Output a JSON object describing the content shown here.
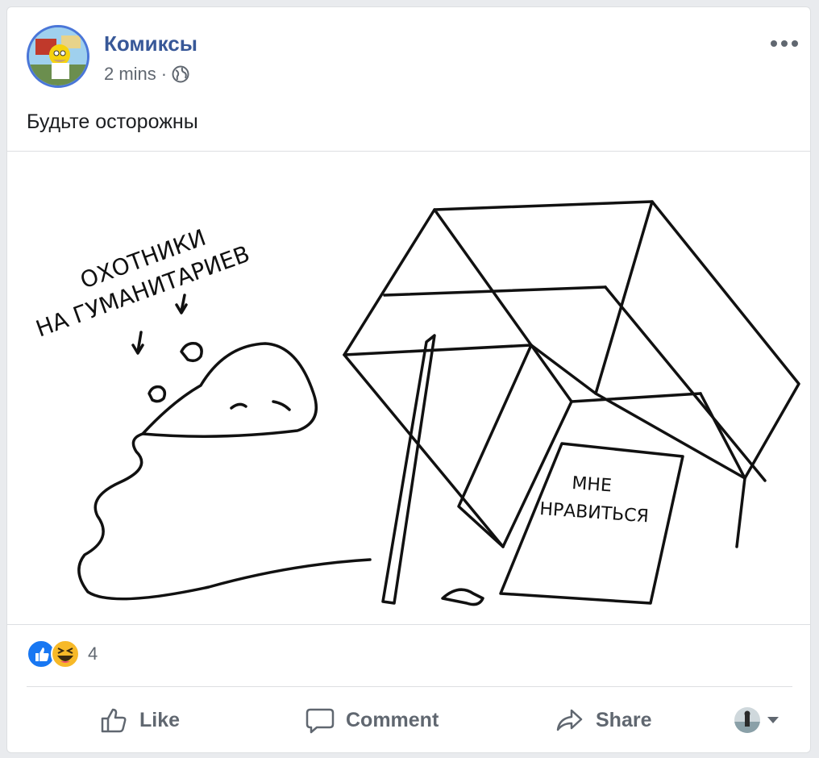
{
  "post": {
    "page_name": "Комиксы",
    "time": "2 mins",
    "separator": "·",
    "privacy_icon": "globe-icon",
    "more_icon": "more-icon",
    "text": "Будьте осторожны"
  },
  "comic": {
    "label_left_line1": "ОХОТНИКИ",
    "label_left_line2": "НА ГУМАНИТАРИЕВ",
    "sign_line1": "МНЕ",
    "sign_line2": "НРАВИТЬСЯ"
  },
  "reactions": {
    "icons": [
      "like-reaction-icon",
      "haha-reaction-icon"
    ],
    "count": "4"
  },
  "actions": {
    "like": "Like",
    "comment": "Comment",
    "share": "Share"
  },
  "colors": {
    "link": "#385898",
    "secondary_text": "#606770",
    "like_blue": "#1877f2",
    "haha_yellow": "#f7b928"
  }
}
